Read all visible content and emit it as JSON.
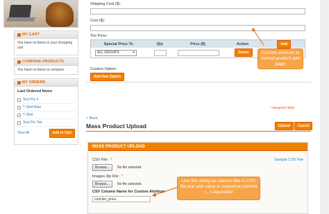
{
  "sidebar": {
    "cart": {
      "title": "MY CART",
      "text": "You have no items in your shopping cart."
    },
    "compare": {
      "title": "COMPARE PRODUCTS",
      "text": "You have no items to compare."
    },
    "orders": {
      "title": "MY ORDERS",
      "subtitle": "Last Ordered Items",
      "items": [
        {
          "label": "Test Pro 4"
        },
        {
          "label": "T Shirt-Blue"
        },
        {
          "label": "T Shirt"
        },
        {
          "label": "Test Pro Tier"
        }
      ],
      "view_all": "View All",
      "add_to_cart": "Add to Cart"
    }
  },
  "form": {
    "shipping_label": "Shipping Cost ($):",
    "cost_label": "Cost ($):",
    "tier_label": "Tier Price:",
    "tier_headers": {
      "special": "Special Price To",
      "qty": "Qty",
      "price": "Price ($)",
      "action": "Action"
    },
    "tier_add": "Add",
    "tier_group": "ALL GROUPS",
    "tier_delete": "Delete",
    "custom_option_label": "Custom Option :",
    "add_option": "Add New Option",
    "callout1": "Custom attribute in normal product add page"
  },
  "upload": {
    "required_note": "* Required Fields",
    "back": "« Back",
    "title": "Mass Product Upload",
    "upload_btn": "Upload",
    "cancel_btn": "Cancel",
    "section_title": "MASS PRODUCT UPLOAD",
    "csv_label": "CSV File :",
    "sample_link": "Sample CSV File",
    "browse": "Browse...",
    "no_file": "No file selected.",
    "images_label": "Images Zip File :",
    "column_label": "CSV Column Name for Custom Attribute",
    "column_value": "cost,tier_price,",
    "callout2": "Use this string as column title in CSV file and add value in sequence comma ( , ) separated"
  },
  "colors": {
    "accent": "#f18200",
    "link": "#1e7ec8",
    "callout": "#f7a54a"
  }
}
